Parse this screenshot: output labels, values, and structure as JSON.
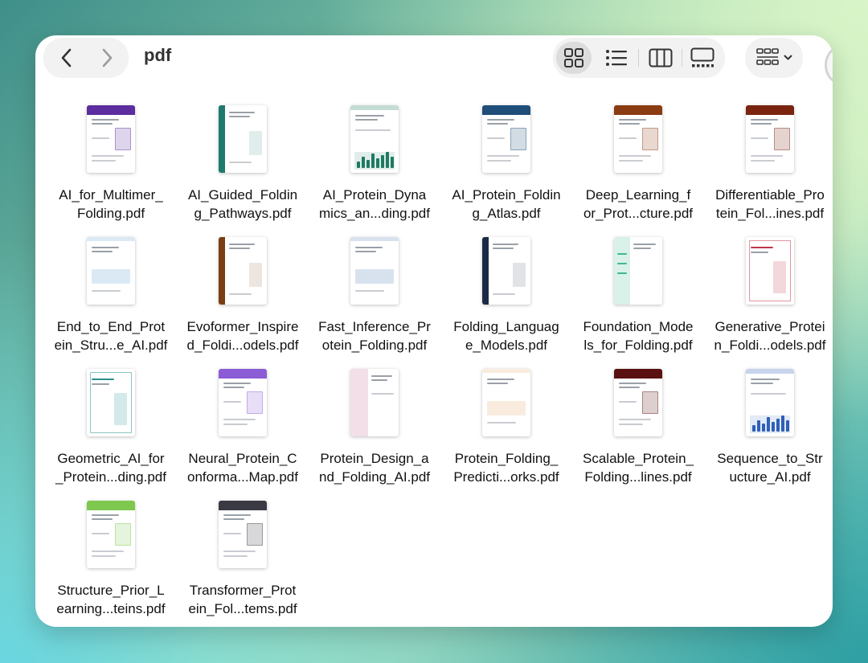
{
  "window": {
    "title": "pdf"
  },
  "toolbar": {
    "back_icon": "chevron-left-icon",
    "forward_icon": "chevron-right-icon",
    "views": [
      {
        "name": "icon-view",
        "icon": "grid-icon",
        "active": true
      },
      {
        "name": "list-view",
        "icon": "list-icon",
        "active": false
      },
      {
        "name": "column-view",
        "icon": "columns-icon",
        "active": false
      },
      {
        "name": "gallery-view",
        "icon": "gallery-icon",
        "active": false
      }
    ],
    "group_icon": "group-by-icon"
  },
  "files": [
    {
      "line1": "AI_for_Multimer_",
      "line2": "Folding.pdf",
      "accent": "#5b2d9e",
      "style": "top"
    },
    {
      "line1": "AI_Guided_Foldin",
      "line2": "g_Pathways.pdf",
      "accent": "#1e7a6e",
      "style": "side"
    },
    {
      "line1": "AI_Protein_Dyna",
      "line2": "mics_an...ding.pdf",
      "accent": "#1f7a63",
      "style": "bars"
    },
    {
      "line1": "AI_Protein_Foldin",
      "line2": "g_Atlas.pdf",
      "accent": "#1f4e79",
      "style": "top"
    },
    {
      "line1": "Deep_Learning_f",
      "line2": "or_Prot...cture.pdf",
      "accent": "#8a3b12",
      "style": "top"
    },
    {
      "line1": "Differentiable_Pro",
      "line2": "tein_Fol...ines.pdf",
      "accent": "#7a2410",
      "style": "top"
    },
    {
      "line1": "End_to_End_Prot",
      "line2": "ein_Stru...e_AI.pdf",
      "accent": "#4a8fc6",
      "style": "plain"
    },
    {
      "line1": "Evoformer_Inspire",
      "line2": "d_Foldi...odels.pdf",
      "accent": "#7a3e12",
      "style": "side"
    },
    {
      "line1": "Fast_Inference_Pr",
      "line2": "otein_Folding.pdf",
      "accent": "#3a6fb0",
      "style": "plain"
    },
    {
      "line1": "Folding_Languag",
      "line2": "e_Models.pdf",
      "accent": "#1b2a44",
      "style": "side"
    },
    {
      "line1": "Foundation_Mode",
      "line2": "ls_for_Folding.pdf",
      "accent": "#3fb98a",
      "style": "greenside"
    },
    {
      "line1": "Generative_Protei",
      "line2": "n_Foldi...odels.pdf",
      "accent": "#c0364a",
      "style": "border"
    },
    {
      "line1": "Geometric_AI_for",
      "line2": "_Protein...ding.pdf",
      "accent": "#2a8f8f",
      "style": "border"
    },
    {
      "line1": "Neural_Protein_C",
      "line2": "onforma...Map.pdf",
      "accent": "#8b5cd6",
      "style": "top"
    },
    {
      "line1": "Protein_Design_a",
      "line2": "nd_Folding_AI.pdf",
      "accent": "#d8a0b8",
      "style": "pinkside"
    },
    {
      "line1": "Protein_Folding_",
      "line2": "Predicti...orks.pdf",
      "accent": "#e0a060",
      "style": "plain"
    },
    {
      "line1": "Scalable_Protein_",
      "line2": "Folding...lines.pdf",
      "accent": "#5a1010",
      "style": "top"
    },
    {
      "line1": "Sequence_to_Str",
      "line2": "ucture_AI.pdf",
      "accent": "#2f5fb8",
      "style": "bars"
    },
    {
      "line1": "Structure_Prior_L",
      "line2": "earning...teins.pdf",
      "accent": "#7ec850",
      "style": "top"
    },
    {
      "line1": "Transformer_Prot",
      "line2": "ein_Fol...tems.pdf",
      "accent": "#3a3a44",
      "style": "top"
    }
  ]
}
